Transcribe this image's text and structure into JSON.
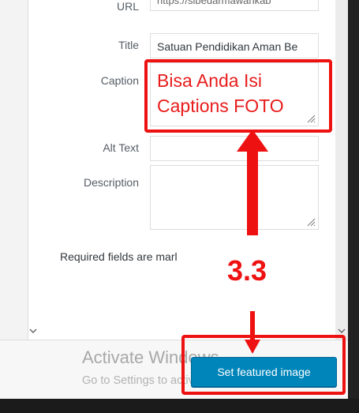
{
  "fields": {
    "url": {
      "label": "URL",
      "value": "https://sibedarmawankab"
    },
    "title": {
      "label": "Title",
      "value": "Satuan Pendidikan Aman Be"
    },
    "caption": {
      "label": "Caption",
      "value": "Bisa Anda Isi Captions FOTO"
    },
    "alt_text": {
      "label": "Alt Text",
      "value": ""
    },
    "description": {
      "label": "Description",
      "value": ""
    }
  },
  "required_note": "Required fields are marl",
  "annotation": {
    "step": "3.3",
    "color": "#ee1111"
  },
  "watermark": {
    "title": "Activate Windows",
    "subtitle": "Go to Settings to activate Windows."
  },
  "toolbar": {
    "set_featured_label": "Set featured image",
    "button_color": "#0085ba"
  },
  "icons": {
    "scroll_left": "chevron-down-icon",
    "scroll_right": "chevron-down-icon"
  }
}
